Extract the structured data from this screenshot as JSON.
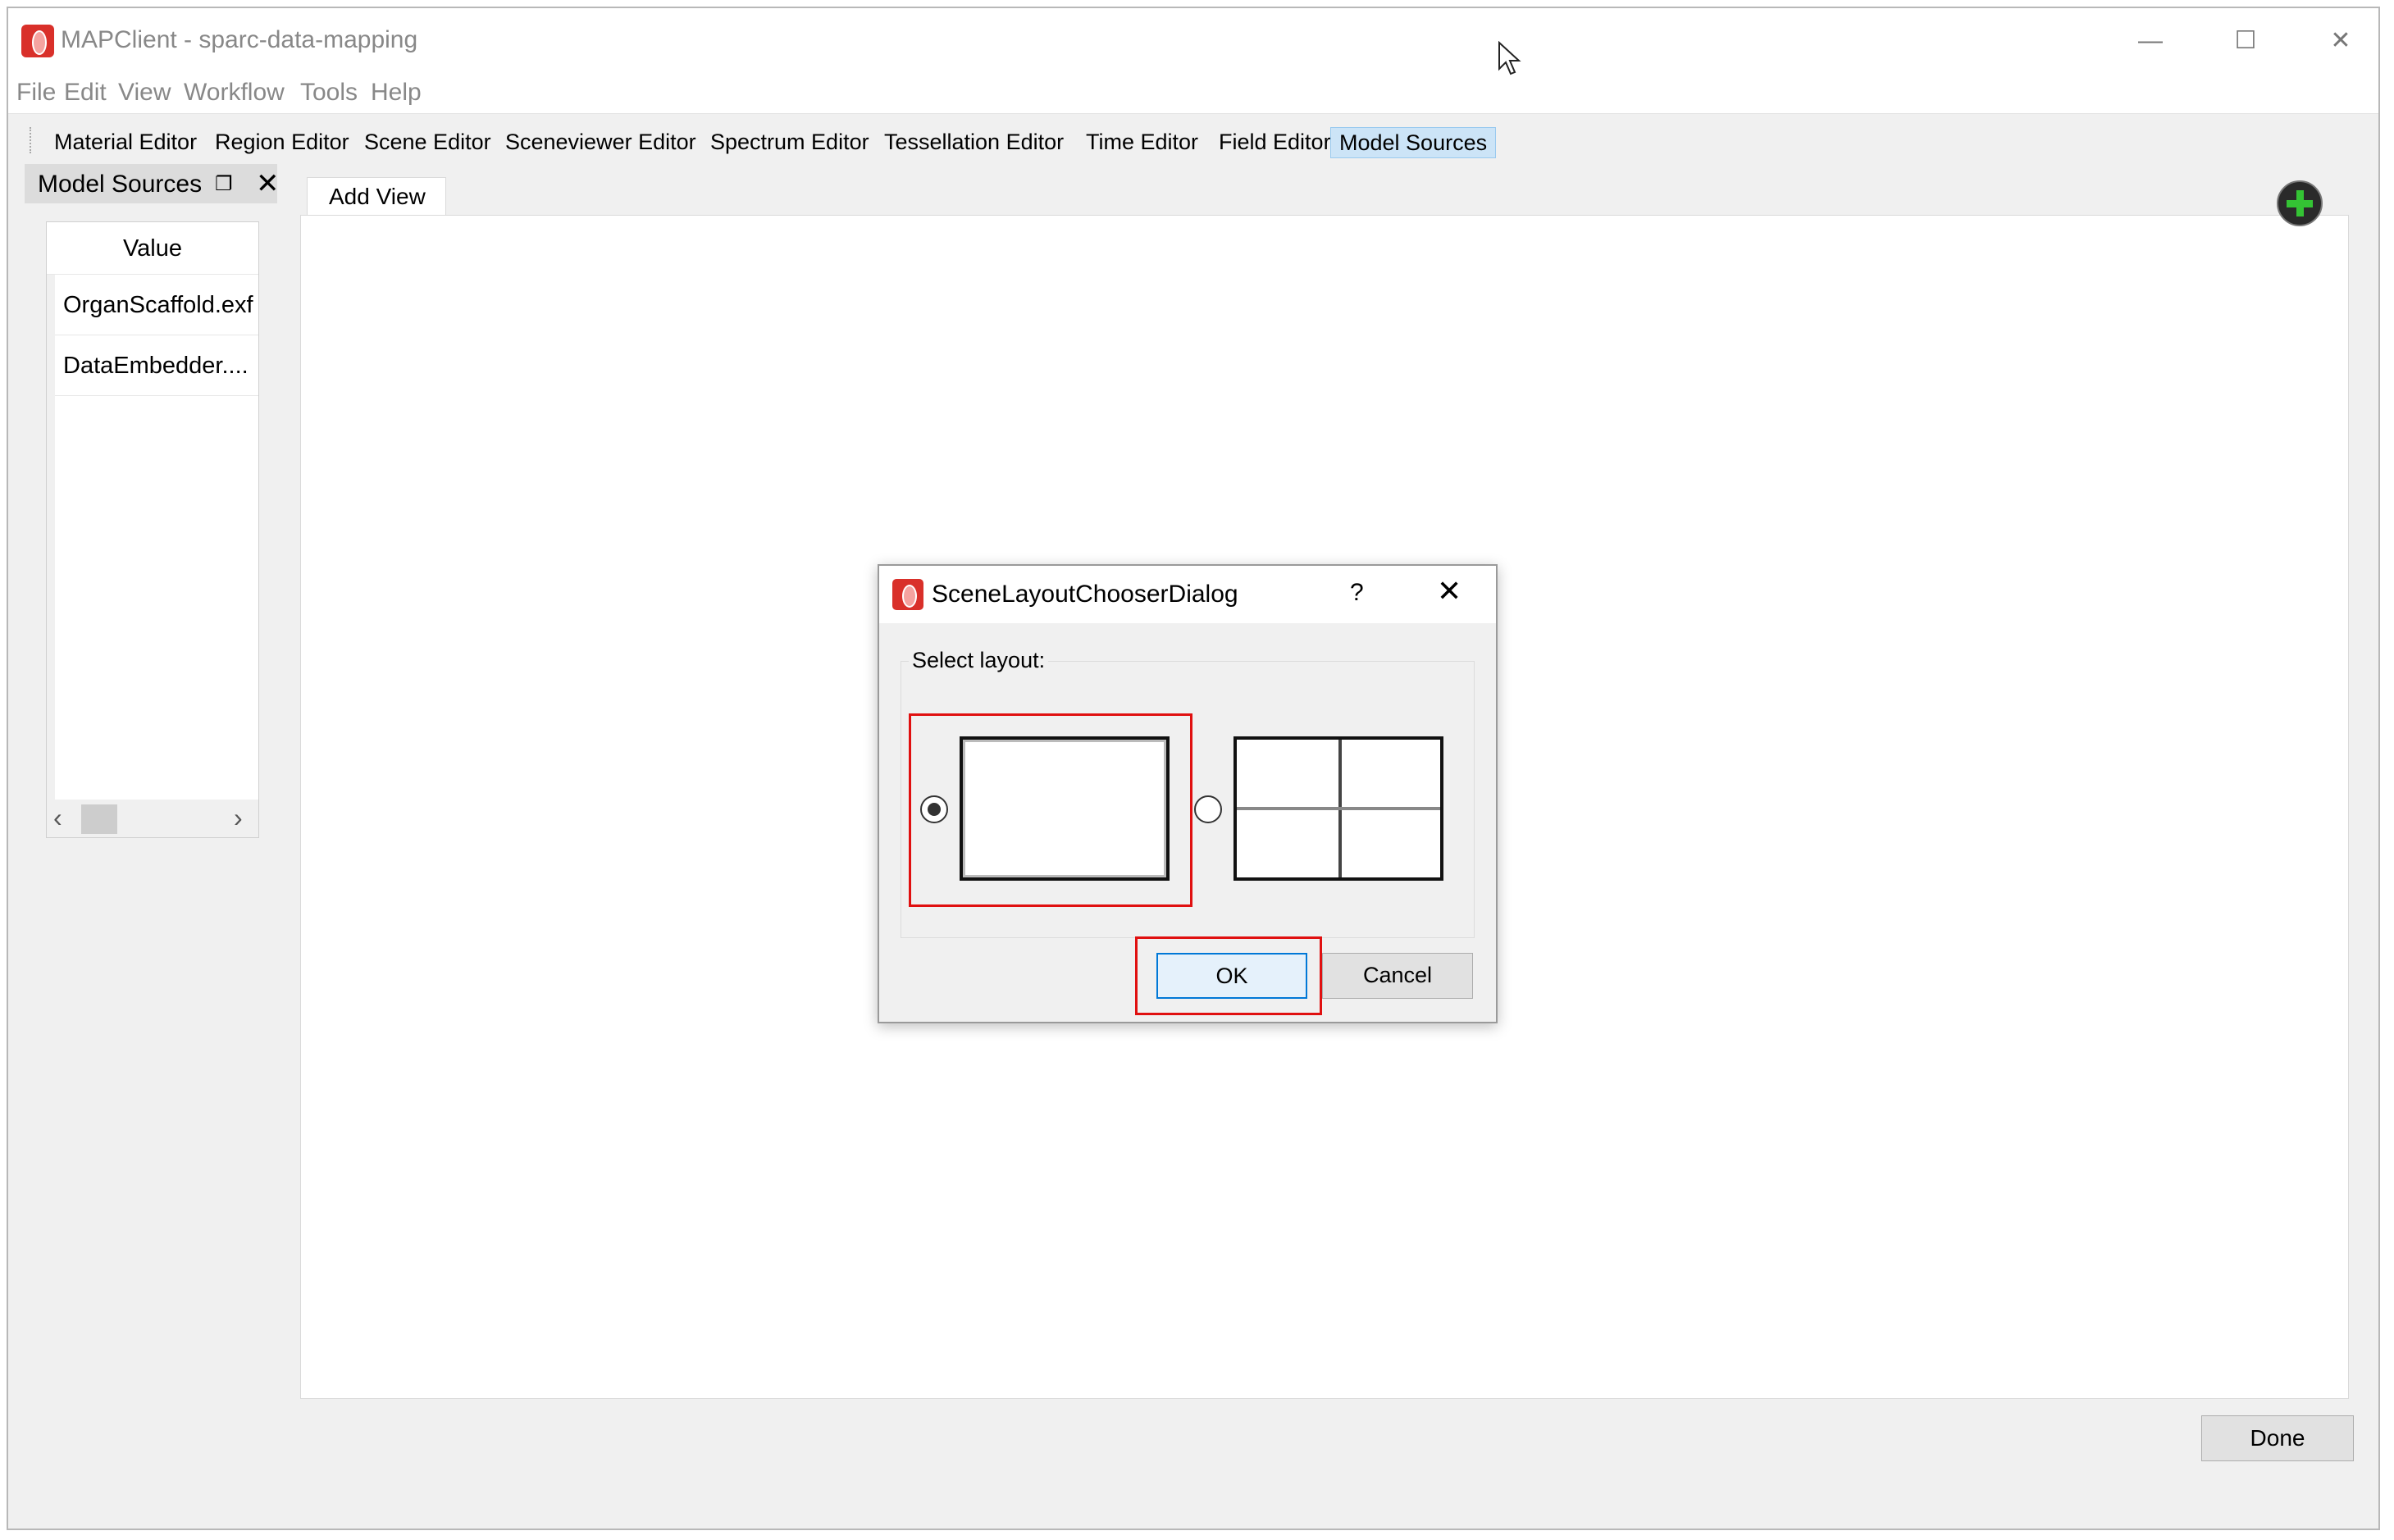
{
  "window": {
    "title": "MAPClient - sparc-data-mapping"
  },
  "menubar": {
    "items": [
      "File",
      "Edit",
      "View",
      "Workflow",
      "Tools",
      "Help"
    ]
  },
  "toolbar": {
    "items": [
      "Material Editor",
      "Region Editor",
      "Scene Editor",
      "Sceneviewer Editor",
      "Spectrum Editor",
      "Tessellation Editor",
      "Time Editor",
      "Field Editor",
      "Model Sources"
    ],
    "active": "Model Sources"
  },
  "dock": {
    "title": "Model Sources",
    "column_header": "Value",
    "rows": [
      "OrganScaffold.exf",
      "DataEmbedder...."
    ]
  },
  "main": {
    "tab_label": "Add View",
    "done_label": "Done"
  },
  "dialog": {
    "title": "SceneLayoutChooserDialog",
    "help_label": "?",
    "group_label": "Select layout:",
    "selected_layout": "single",
    "ok_label": "OK",
    "cancel_label": "Cancel"
  },
  "colors": {
    "accent": "#0078d7",
    "highlight": "#e01010",
    "active_tab": "#cce4f7"
  }
}
